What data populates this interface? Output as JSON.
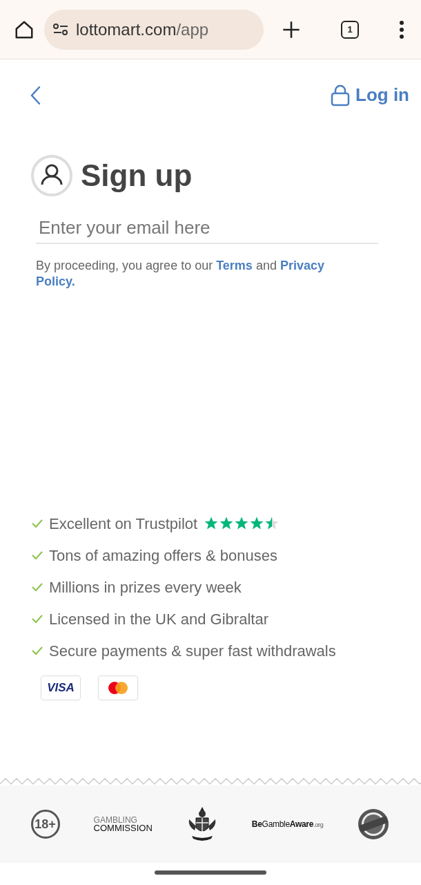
{
  "browser": {
    "url_host": "lottomart.com",
    "url_path": "/app",
    "tab_count": "1"
  },
  "header": {
    "login": "Log in"
  },
  "signup": {
    "title": "Sign up",
    "email_placeholder": "Enter your email here",
    "consent": "By proceeding, you agree to our **Terms** and **Privacy Policy.**"
  },
  "features": [
    {
      "text": "Excellent on Trustpilot",
      "stars": 4.5
    },
    {
      "text": "Tons of amazing offers & bonuses"
    },
    {
      "text": "Millions in prizes every week"
    },
    {
      "text": "Licensed in the UK and Gibraltar"
    },
    {
      "text": "Secure payments & super fast withdrawals"
    }
  ],
  "payment_cards": [
    {
      "kind": "visa",
      "label": "VISA"
    },
    {
      "kind": "mastercard"
    }
  ],
  "footer_logos": [
    {
      "kind": "age",
      "label": "18+"
    },
    {
      "kind": "commission",
      "line1": "GAMBLING",
      "line2": "COMMISSION"
    },
    {
      "kind": "crest"
    },
    {
      "kind": "aware",
      "bold1": "Be",
      "plain1": "Gamble",
      "bold2": "Aware",
      "suffix": ".org"
    },
    {
      "kind": "seal"
    }
  ]
}
